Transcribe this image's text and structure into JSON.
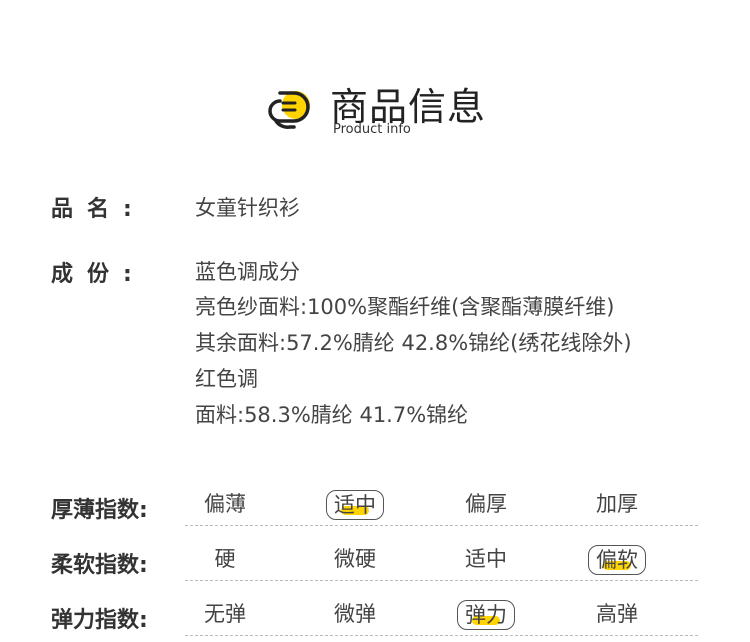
{
  "header": {
    "title": "商品信息",
    "subtitle": "Product info",
    "logo_icon": "document-lines-icon",
    "accent_color": "#ffd400"
  },
  "fields": {
    "name_label": "品名:",
    "name_value": "女童针织衫",
    "composition_label": "成份:",
    "composition_lines": [
      "蓝色调成分",
      "亮色纱面料:100%聚酯纤维(含聚酯薄膜纤维)",
      "其余面料:57.2%腈纶 42.8%锦纶(绣花线除外)",
      "红色调",
      "面料:58.3%腈纶 41.7%锦纶"
    ]
  },
  "indices": [
    {
      "label": "厚薄指数:",
      "options": [
        "偏薄",
        "适中",
        "偏厚",
        "加厚"
      ],
      "selected": "适中"
    },
    {
      "label": "柔软指数:",
      "options": [
        "硬",
        "微硬",
        "适中",
        "偏软"
      ],
      "selected": "偏软"
    },
    {
      "label": "弹力指数:",
      "options": [
        "无弹",
        "微弹",
        "弹力",
        "高弹"
      ],
      "selected": "弹力"
    }
  ]
}
